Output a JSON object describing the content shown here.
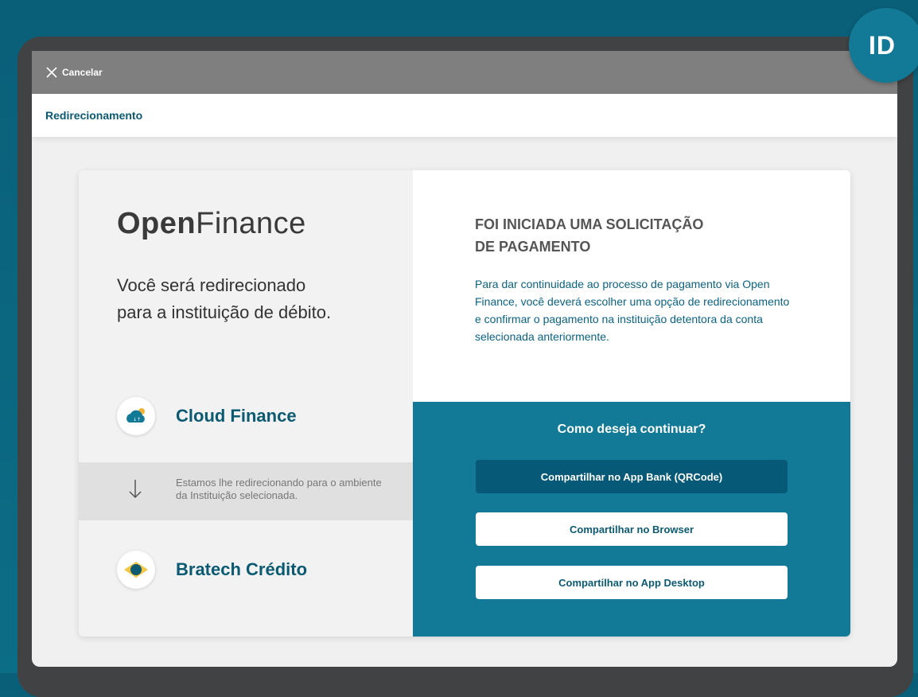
{
  "topbar": {
    "cancel_label": "Cancelar"
  },
  "header": {
    "title": "Redirecionamento"
  },
  "brand": {
    "logo_bold": "Open",
    "logo_light": "Finance",
    "accent": "#127a96"
  },
  "left": {
    "lead_line1": "Você será redirecionado",
    "lead_line2": "para a instituição de débito.",
    "origin": {
      "name": "Cloud Finance",
      "icon": "cloud-icon"
    },
    "redirect_text": "Estamos lhe redirecionando para o ambiente da Instituição selecionada.",
    "destination": {
      "name": "Bratech Crédito",
      "icon": "bratech-logo-icon"
    }
  },
  "right": {
    "title_line1": "FOI INICIADA UMA SOLICITAÇÃO",
    "title_line2": "DE PAGAMENTO",
    "description": "Para dar continuidade ao processo de pagamento via Open Finance, você deverá escolher uma opção de redirecionamento e confirmar o pagamento na instituição detentora da conta selecionada anteriormente.",
    "question": "Como deseja continuar?",
    "buttons": [
      {
        "label": "Compartilhar no App Bank (QRCode)"
      },
      {
        "label": "Compartilhar no Browser"
      },
      {
        "label": "Compartilhar no App Desktop"
      }
    ]
  },
  "badge": {
    "label": "ID"
  }
}
